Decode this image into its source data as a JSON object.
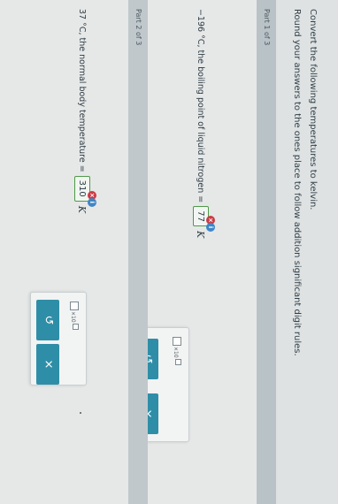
{
  "instructions": {
    "line1": "Convert the following temperatures to kelvin.",
    "line2": "Round your answers to the ones place to follow addition significant digit rules."
  },
  "part1": {
    "header": "Part 1 of 3",
    "question": "−196 °C, the boiling point of liquid nitrogen =",
    "answer": "77",
    "unit": "K",
    "status": "incorrect",
    "undo_label": "↺",
    "clear_label": "×",
    "sci_x10": "×10"
  },
  "part2": {
    "header": "Part 2 of 3",
    "question": "37 °C, the normal body temperature =",
    "answer": "310",
    "unit": "K",
    "status": "incorrect",
    "undo_label": "↺",
    "clear_label": "×",
    "sci_x10": "×10"
  },
  "colors": {
    "accent": "#2f8ea7",
    "incorrect": "#cc3b45",
    "info": "#3f86c7",
    "answer_border": "#4e9a48"
  },
  "icons": {
    "incorrect": "x-circle-icon",
    "info": "info-circle-icon",
    "undo": "undo-icon",
    "clear": "clear-x-icon",
    "sci_notation": "scientific-notation-icon"
  }
}
